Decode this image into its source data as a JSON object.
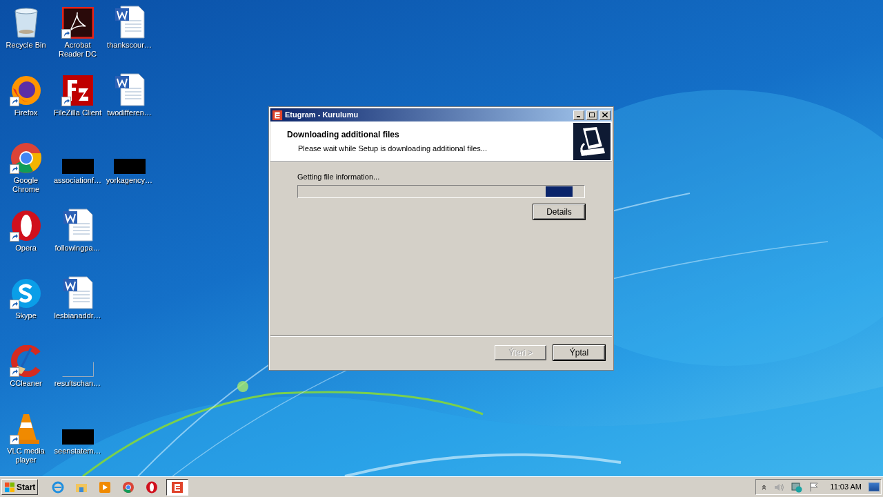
{
  "desktop_icons": [
    {
      "label": "Recycle Bin",
      "kind": "recycle",
      "shortcut": false
    },
    {
      "label": "Firefox",
      "kind": "firefox",
      "shortcut": true
    },
    {
      "label": "Google Chrome",
      "kind": "chrome",
      "shortcut": true
    },
    {
      "label": "Opera",
      "kind": "opera",
      "shortcut": true
    },
    {
      "label": "Skype",
      "kind": "skype",
      "shortcut": true
    },
    {
      "label": "CCleaner",
      "kind": "ccleaner",
      "shortcut": true
    },
    {
      "label": "VLC media player",
      "kind": "vlc",
      "shortcut": true
    },
    {
      "label": "Acrobat Reader DC",
      "kind": "acrobat",
      "shortcut": true
    },
    {
      "label": "FileZilla Client",
      "kind": "filezilla",
      "shortcut": true
    },
    {
      "label": "associationf…",
      "kind": "black",
      "shortcut": false
    },
    {
      "label": "followingpa…",
      "kind": "word",
      "shortcut": false
    },
    {
      "label": "lesbianaddr…",
      "kind": "word",
      "shortcut": false
    },
    {
      "label": "resultschan…",
      "kind": "blank",
      "shortcut": false
    },
    {
      "label": "seenstatem…",
      "kind": "black",
      "shortcut": false
    },
    {
      "label": "thankscour…",
      "kind": "word",
      "shortcut": false
    },
    {
      "label": "twodifferen…",
      "kind": "word",
      "shortcut": false
    },
    {
      "label": "yorkagency…",
      "kind": "black",
      "shortcut": false
    }
  ],
  "dialog": {
    "title": "Etugram - Kurulumu",
    "heading": "Downloading additional files",
    "subheading": "Please wait while Setup is downloading additional files...",
    "status": "Getting file information...",
    "progress": {
      "level": 0.96
    },
    "details_button": "Details",
    "buttons": [
      {
        "label": "Ýleri >",
        "disabled": true
      },
      {
        "label": "Ýptal",
        "disabled": false
      }
    ]
  },
  "taskbar": {
    "start": "Start",
    "apps": [
      {
        "kind": "ie",
        "selected": false
      },
      {
        "kind": "folder",
        "selected": false
      },
      {
        "kind": "media",
        "selected": false
      },
      {
        "kind": "chrome",
        "selected": false
      },
      {
        "kind": "opera",
        "selected": false
      },
      {
        "kind": "etugram",
        "selected": true
      }
    ],
    "clock": "11:03 AM"
  }
}
